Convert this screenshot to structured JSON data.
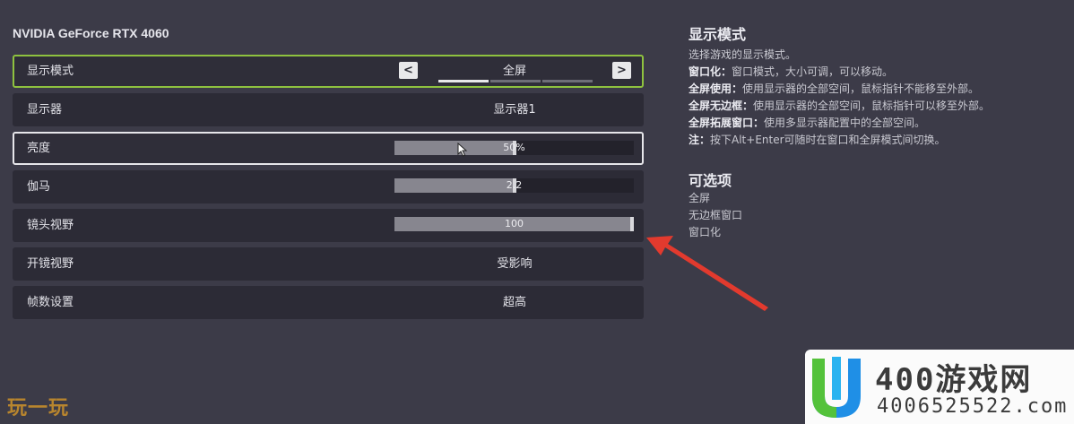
{
  "gpu_name": "NVIDIA GeForce RTX 4060",
  "settings": [
    {
      "label": "显示模式",
      "value": "全屏",
      "kind": "selector",
      "option_count": 3,
      "selected_index": 0
    },
    {
      "label": "显示器",
      "value": "显示器1",
      "kind": "value"
    },
    {
      "label": "亮度",
      "value": "50%",
      "kind": "slider",
      "fraction": 0.5
    },
    {
      "label": "伽马",
      "value": "2.2",
      "kind": "slider",
      "fraction": 0.5
    },
    {
      "label": "镜头视野",
      "value": "100",
      "kind": "slider",
      "fraction": 1.0
    },
    {
      "label": "开镜视野",
      "value": "受影响",
      "kind": "value"
    },
    {
      "label": "帧数设置",
      "value": "超高",
      "kind": "value"
    }
  ],
  "selector_prev": "<",
  "selector_next": ">",
  "info": {
    "title": "显示模式",
    "intro": "选择游戏的显示模式。",
    "lines": [
      {
        "key": "窗口化：",
        "text": "窗口模式，大小可调，可以移动。"
      },
      {
        "key": "全屏使用：",
        "text": "使用显示器的全部空间，鼠标指针不能移至外部。"
      },
      {
        "key": "全屏无边框：",
        "text": "使用显示器的全部空间，鼠标指针可以移至外部。"
      },
      {
        "key": "全屏拓展窗口：",
        "text": "使用多显示器配置中的全部空间。"
      },
      {
        "key": "注：",
        "text": "按下Alt+Enter可随时在窗口和全屏模式间切换。"
      }
    ],
    "options_title": "可选项",
    "options": [
      "全屏",
      "无边框窗口",
      "窗口化"
    ]
  },
  "watermark_left": "玩一玩",
  "watermark_right": {
    "name": "400游戏网",
    "number": "4006525522.com"
  },
  "colors": {
    "accent_green": "#8ec23f",
    "arrow_red": "#e23a2e",
    "logo_blue": "#1f8fe6",
    "logo_green": "#54c23b"
  }
}
